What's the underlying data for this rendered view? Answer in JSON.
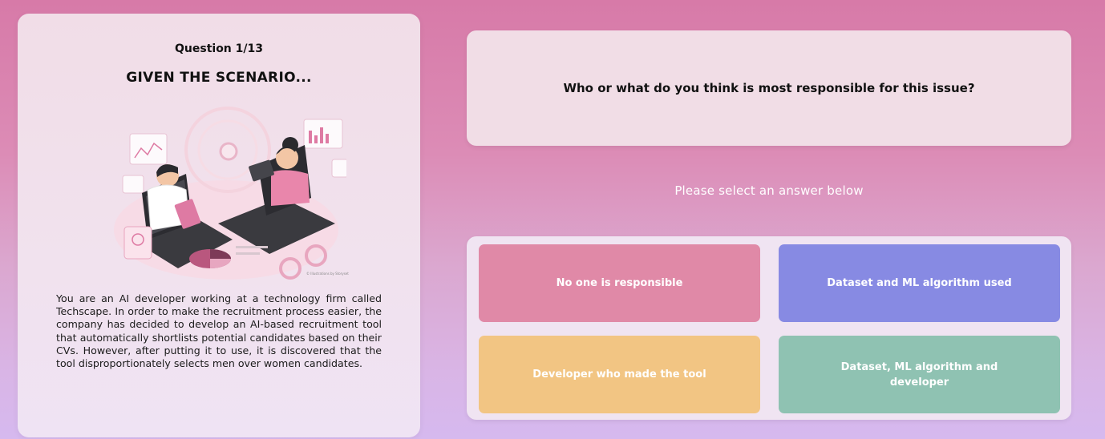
{
  "scenario": {
    "question_counter": "Question 1/13",
    "title": "GIVEN THE SCENARIO...",
    "illustration_credit": "© Illustrations by Storyset",
    "text": "You are an AI developer working at a technology firm called Techscape. In order to make the recruitment process easier, the company has decided to develop an AI-based recruitment tool that automatically shortlists potential candidates based on their CVs. However, after putting it to use, it is discovered that the tool disproportionately selects men over women candidates."
  },
  "question": {
    "text": "Who or what do you think is most responsible for this issue?"
  },
  "prompt": "Please select an answer below",
  "answers": [
    {
      "label": "No one is responsible",
      "color": "#e089a7"
    },
    {
      "label": "Dataset and ML algorithm used",
      "color": "#878ae3"
    },
    {
      "label": "Developer who made the tool",
      "color": "#f2c583"
    },
    {
      "label": "Dataset, ML algorithm and developer",
      "color": "#8fc2b2"
    }
  ]
}
